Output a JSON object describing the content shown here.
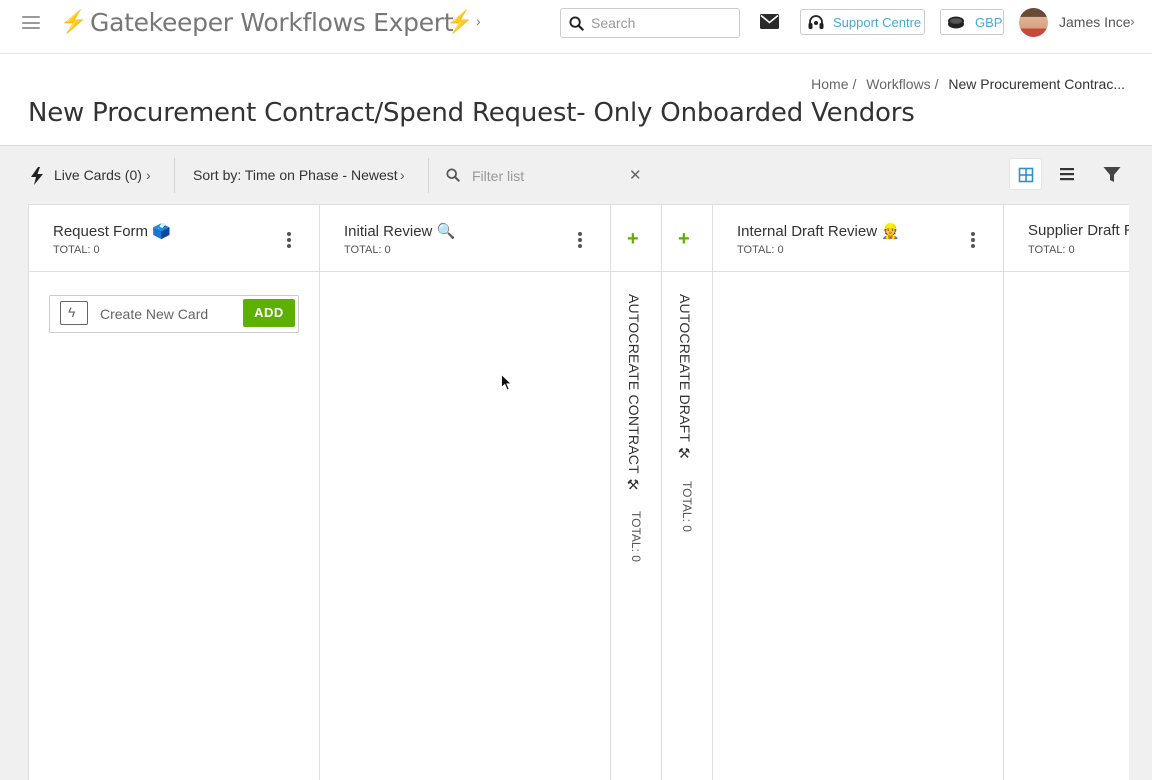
{
  "topbar": {
    "app_title": "Gatekeeper Workflows Expert",
    "bolt_glyph": "⚡",
    "title_chevron": "›",
    "search_placeholder": "Search",
    "support_label": "Support Centre",
    "currency_label": "GBP",
    "user_name": "James Ince",
    "user_chevron": "›"
  },
  "breadcrumb": {
    "items": [
      "Home",
      "Workflows"
    ],
    "separator": "/",
    "current": "New Procurement Contrac..."
  },
  "page": {
    "title": "New Procurement Contract/Spend Request- Only Onboarded Vendors"
  },
  "toolbar": {
    "live_cards": "Live Cards (0)",
    "sort_by": "Sort by: Time on Phase - Newest",
    "chevron": "›",
    "filter_placeholder": "Filter list",
    "clear_glyph": "✕"
  },
  "board": {
    "columns": [
      {
        "title": "Request Form 🗳️",
        "total": "TOTAL: 0"
      },
      {
        "title": "Initial Review 🔍",
        "total": "TOTAL: 0"
      },
      {
        "title": "AUTOCREATE CONTRACT ⚒",
        "total": "TOTAL: 0",
        "collapsed": true
      },
      {
        "title": "AUTOCREATE DRAFT ⚒",
        "total": "TOTAL: 0",
        "collapsed": true
      },
      {
        "title": "Internal Draft Review 👷",
        "total": "TOTAL: 0"
      },
      {
        "title": "Supplier Draft R",
        "total": "TOTAL: 0"
      }
    ],
    "plus_glyph": "+",
    "create_card_placeholder": "Create New Card",
    "add_label": "ADD",
    "create_card_bolt": "ϟ"
  },
  "colors": {
    "accent_green": "#5cb000",
    "link_blue": "#4aa8d8",
    "bolt_yellow": "#f4c21a"
  }
}
